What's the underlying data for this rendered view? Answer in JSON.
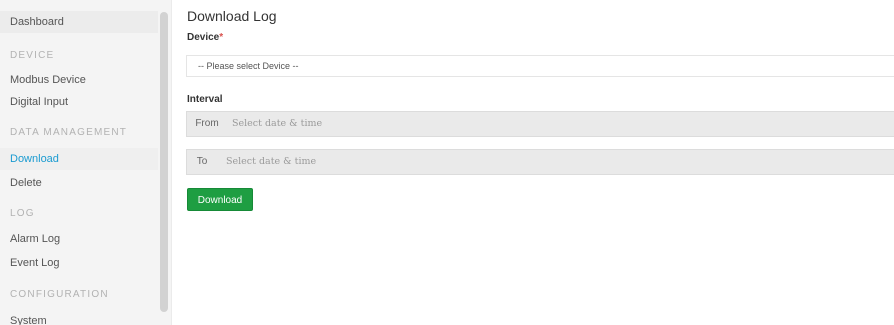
{
  "sidebar": {
    "items": [
      {
        "label": "Dashboard"
      },
      {
        "section": "DEVICE"
      },
      {
        "label": "Modbus Device"
      },
      {
        "label": "Digital Input"
      },
      {
        "section": "DATA MANAGEMENT"
      },
      {
        "label": "Download"
      },
      {
        "label": "Delete"
      },
      {
        "section": "LOG"
      },
      {
        "label": "Alarm Log"
      },
      {
        "label": "Event Log"
      },
      {
        "section": "CONFIGURATION"
      },
      {
        "label": "System"
      }
    ],
    "selected": "Download"
  },
  "main": {
    "title": "Download Log",
    "device_label": "Device",
    "required_mark": "*",
    "device_select": {
      "value": "-- Please select Device --"
    },
    "interval_label": "Interval",
    "from": {
      "addon": "From",
      "placeholder": "Select date & time"
    },
    "to": {
      "addon": "To",
      "placeholder": "Select date & time"
    },
    "download_button": "Download"
  },
  "colors": {
    "accent": "#1a9bd1",
    "button": "#1e9e42",
    "required": "#d9534f"
  }
}
